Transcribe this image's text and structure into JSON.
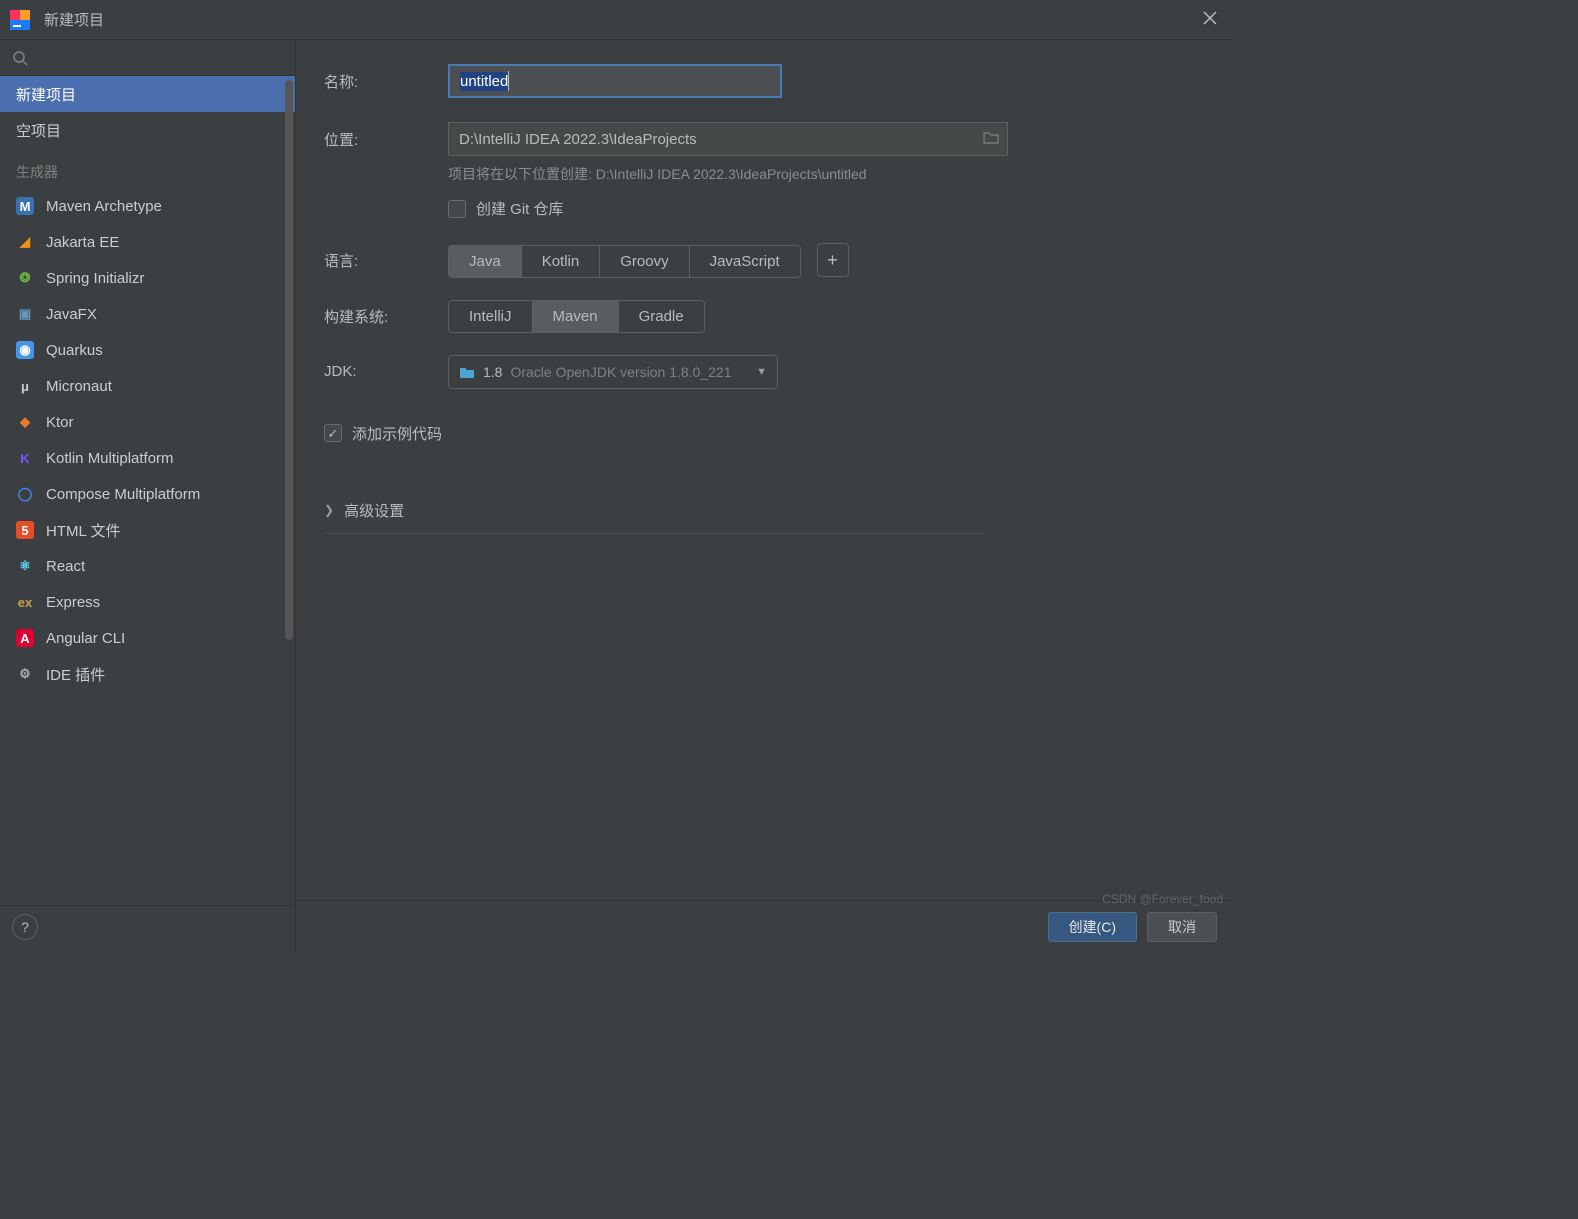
{
  "window": {
    "title": "新建项目"
  },
  "sidebar": {
    "section_label": "生成器",
    "items": [
      {
        "label": "新建项目",
        "icon": null,
        "selected": true
      },
      {
        "label": "空项目",
        "icon": null,
        "selected": false
      }
    ],
    "generators": [
      {
        "label": "Maven Archetype",
        "icon_letter": "M",
        "icon_bg": "#3a6fb0",
        "icon_fg": "#ffffff"
      },
      {
        "label": "Jakarta EE",
        "icon_letter": "◢",
        "icon_bg": "transparent",
        "icon_fg": "#f29111"
      },
      {
        "label": "Spring Initializr",
        "icon_letter": "❂",
        "icon_bg": "transparent",
        "icon_fg": "#6db33f"
      },
      {
        "label": "JavaFX",
        "icon_letter": "▣",
        "icon_bg": "transparent",
        "icon_fg": "#6897bb"
      },
      {
        "label": "Quarkus",
        "icon_letter": "◉",
        "icon_bg": "#4695eb",
        "icon_fg": "#ffffff"
      },
      {
        "label": "Micronaut",
        "icon_letter": "μ",
        "icon_bg": "transparent",
        "icon_fg": "#cccccc"
      },
      {
        "label": "Ktor",
        "icon_letter": "◆",
        "icon_bg": "transparent",
        "icon_fg": "#e97b2e"
      },
      {
        "label": "Kotlin Multiplatform",
        "icon_letter": "K",
        "icon_bg": "transparent",
        "icon_fg": "#7f52ff"
      },
      {
        "label": "Compose Multiplatform",
        "icon_letter": "◯",
        "icon_bg": "transparent",
        "icon_fg": "#4285f4"
      },
      {
        "label": "HTML 文件",
        "icon_letter": "5",
        "icon_bg": "#e44d26",
        "icon_fg": "#ffffff"
      },
      {
        "label": "React",
        "icon_letter": "⚛",
        "icon_bg": "transparent",
        "icon_fg": "#61dafb"
      },
      {
        "label": "Express",
        "icon_letter": "ex",
        "icon_bg": "transparent",
        "icon_fg": "#c2a143"
      },
      {
        "label": "Angular CLI",
        "icon_letter": "A",
        "icon_bg": "#dd0031",
        "icon_fg": "#ffffff"
      },
      {
        "label": "IDE 插件",
        "icon_letter": "⚙",
        "icon_bg": "transparent",
        "icon_fg": "#aaaaaa"
      }
    ]
  },
  "form": {
    "name_label": "名称:",
    "name_value": "untitled",
    "location_label": "位置:",
    "location_value": "D:\\IntelliJ IDEA 2022.3\\IdeaProjects",
    "location_hint": "项目将在以下位置创建: D:\\IntelliJ IDEA 2022.3\\IdeaProjects\\untitled",
    "git_label": "创建 Git 仓库",
    "git_checked": false,
    "language_label": "语言:",
    "language_options": [
      "Java",
      "Kotlin",
      "Groovy",
      "JavaScript"
    ],
    "language_selected": "Java",
    "build_label": "构建系统:",
    "build_options": [
      "IntelliJ",
      "Maven",
      "Gradle"
    ],
    "build_selected": "Maven",
    "jdk_label": "JDK:",
    "jdk_version": "1.8",
    "jdk_desc": "Oracle OpenJDK version 1.8.0_221",
    "sample_label": "添加示例代码",
    "sample_checked": true,
    "advanced_label": "高级设置"
  },
  "footer": {
    "create": "创建(C)",
    "cancel": "取消"
  },
  "watermark": "CSDN @Forever_food"
}
